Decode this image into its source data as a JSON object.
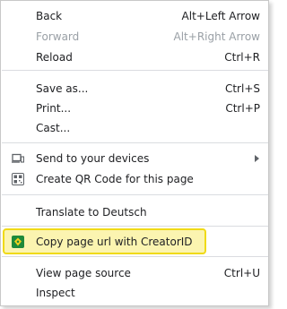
{
  "menu": {
    "items": [
      {
        "label": "Back",
        "shortcut": "Alt+Left Arrow"
      },
      {
        "label": "Forward",
        "shortcut": "Alt+Right Arrow",
        "disabled": true
      },
      {
        "label": "Reload",
        "shortcut": "Ctrl+R"
      },
      {
        "label": "Save as...",
        "shortcut": "Ctrl+S"
      },
      {
        "label": "Print...",
        "shortcut": "Ctrl+P"
      },
      {
        "label": "Cast..."
      },
      {
        "label": "Send to your devices",
        "icon": "devices-icon",
        "submenu": true
      },
      {
        "label": "Create QR Code for this page",
        "icon": "qr-code-icon"
      },
      {
        "label": "Translate to Deutsch"
      },
      {
        "label": "Copy page url with CreatorID",
        "icon": "creatorid-extension-icon",
        "highlighted": true
      },
      {
        "label": "View page source",
        "shortcut": "Ctrl+U"
      },
      {
        "label": "Inspect"
      }
    ]
  },
  "colors": {
    "highlight_fill": "#fbf4b0",
    "highlight_border": "#f0da17",
    "extension_icon_green": "#1e8a3a",
    "extension_icon_yellow": "#f3d21c"
  }
}
